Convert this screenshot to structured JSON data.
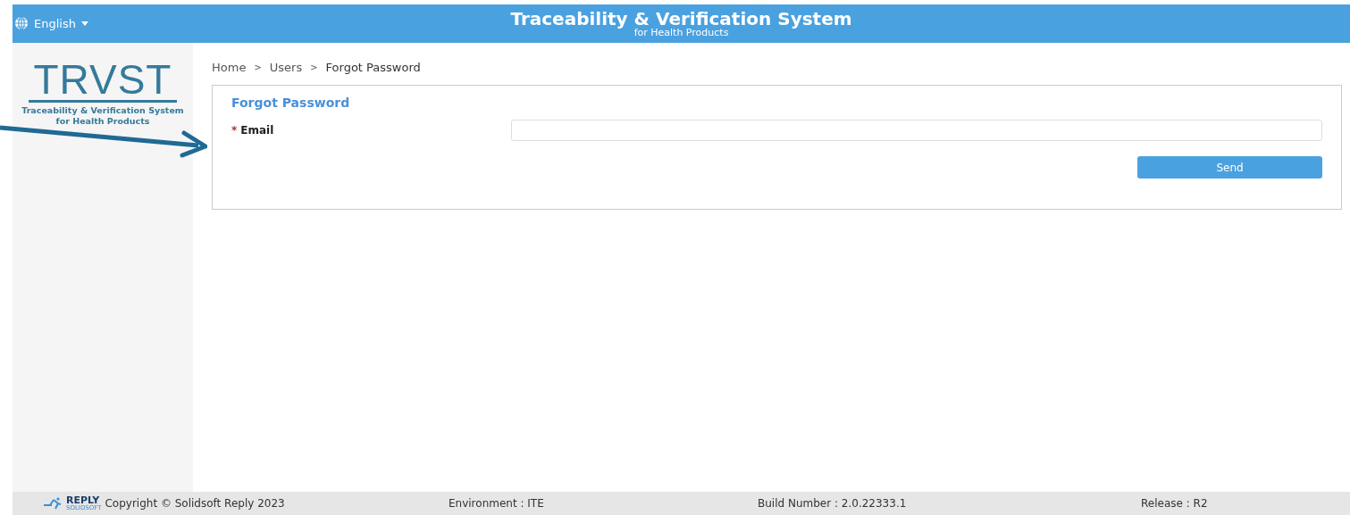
{
  "header": {
    "language": "English",
    "title": "Traceability & Verification System",
    "subtitle": "for Health Products"
  },
  "logo": {
    "mark": "TRVST",
    "tagline": "Traceability & Verification System",
    "tagline_2": "for Health Products"
  },
  "breadcrumb": [
    "Home",
    "Users",
    "Forgot Password"
  ],
  "breadcrumb_separator": ">",
  "form": {
    "title": "Forgot Password",
    "field": {
      "label": "Email",
      "required": true,
      "required_mark": "*"
    },
    "button": "Send"
  },
  "footer": {
    "brand": "REPLY",
    "brand_sub": "SOLIDSOFT",
    "copyright": "Copyright © Solidsoft Reply 2023",
    "environment": "Environment : ITE",
    "build": "Build Number : 2.0.22333.1",
    "release": "Release : R2"
  }
}
